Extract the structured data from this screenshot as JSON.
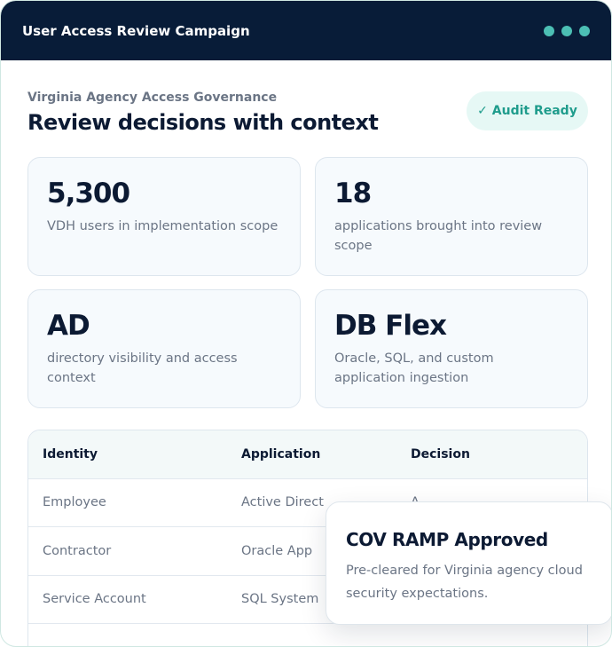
{
  "header": {
    "title": "User Access Review Campaign",
    "dots_color": "#4cbfb4"
  },
  "eyebrow": "Virginia Agency Access Governance",
  "title": "Review decisions with context",
  "badge": "✓ Audit Ready",
  "stats": [
    {
      "value": "5,300",
      "label": "VDH users in implementation scope"
    },
    {
      "value": "18",
      "label": "applications brought into review scope"
    },
    {
      "value": "AD",
      "label": "directory visibility and access context"
    },
    {
      "value": "DB Flex",
      "label": "Oracle, SQL, and custom application ingestion"
    }
  ],
  "table": {
    "headers": [
      "Identity",
      "Application",
      "Decision"
    ],
    "rows": [
      [
        "Employee",
        "Active Direct",
        "A"
      ],
      [
        "Contractor",
        "Oracle App",
        ""
      ],
      [
        "Service Account",
        "SQL System",
        ""
      ]
    ]
  },
  "popover": {
    "title": "COV RAMP Approved",
    "text": "Pre-cleared for Virginia agency cloud security expectations."
  }
}
